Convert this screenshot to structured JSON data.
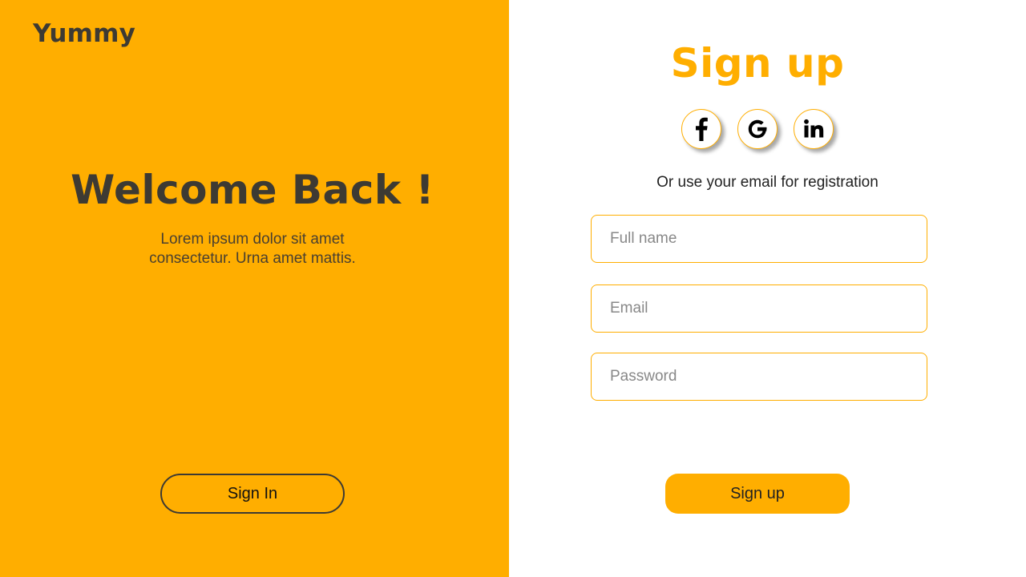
{
  "colors": {
    "accent": "#FFAE00",
    "dark_text": "#3d3a33",
    "white": "#ffffff"
  },
  "left": {
    "brand": "Yummy",
    "title": "Welcome Back !",
    "text_line1": "Lorem ipsum dolor sit amet",
    "text_line2": "consectetur. Urna amet mattis.",
    "signin_label": "Sign In"
  },
  "right": {
    "title": "Sign up",
    "social": [
      {
        "icon": "facebook-icon"
      },
      {
        "icon": "google-icon"
      },
      {
        "icon": "linkedin-icon"
      }
    ],
    "registration_text": "Or use your email for registration",
    "fields": {
      "full_name": {
        "placeholder": "Full name",
        "value": ""
      },
      "email": {
        "placeholder": "Email",
        "value": ""
      },
      "password": {
        "placeholder": "Password",
        "value": ""
      }
    },
    "signup_label": "Sign up"
  }
}
